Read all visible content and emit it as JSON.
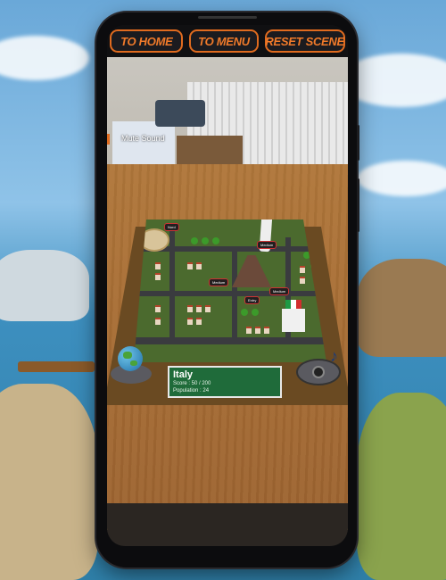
{
  "app": {
    "top_bar": {
      "home_label": "TO HOME",
      "menu_label": "TO MENU",
      "reset_label": "RESET SCENE"
    },
    "mute_label": "Mute Sound",
    "info_panel": {
      "country": "Italy",
      "score_line": "Score : 50 / 200",
      "population_line": "Population : 24"
    },
    "city_tags": [
      "Nord",
      "Medium",
      "Medium",
      "Entry",
      "Medium"
    ],
    "colors": {
      "button_accent": "#e06b1f",
      "panel_bg": "#1f6b3a"
    },
    "icons": [
      "globe-icon",
      "music-note-icon"
    ]
  }
}
